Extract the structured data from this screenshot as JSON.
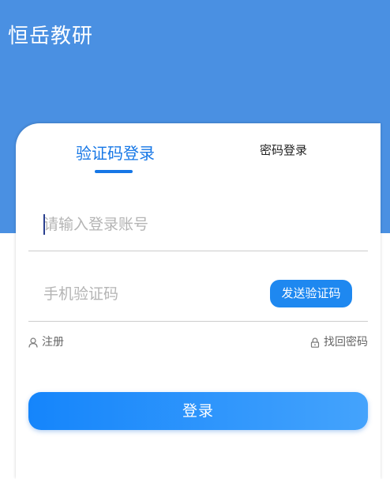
{
  "app": {
    "title": "恒岳教研"
  },
  "tabs": [
    {
      "label": "验证码登录",
      "active": true
    },
    {
      "label": "密码登录",
      "active": false
    }
  ],
  "form": {
    "account_placeholder": "请输入登录账号",
    "account_value": "",
    "sms_placeholder": "手机验证码",
    "sms_value": "",
    "send_code_label": "发送验证码"
  },
  "links": {
    "register_label": "注册",
    "register_icon": "user-icon",
    "find_password_label": "找回密码",
    "find_password_icon": "lock-icon"
  },
  "submit": {
    "label": "登录"
  },
  "colors": {
    "header_bg": "#4a90e2",
    "accent": "#1677e6",
    "button_gradient_start": "#1585fb",
    "button_gradient_end": "#44a3fc"
  }
}
